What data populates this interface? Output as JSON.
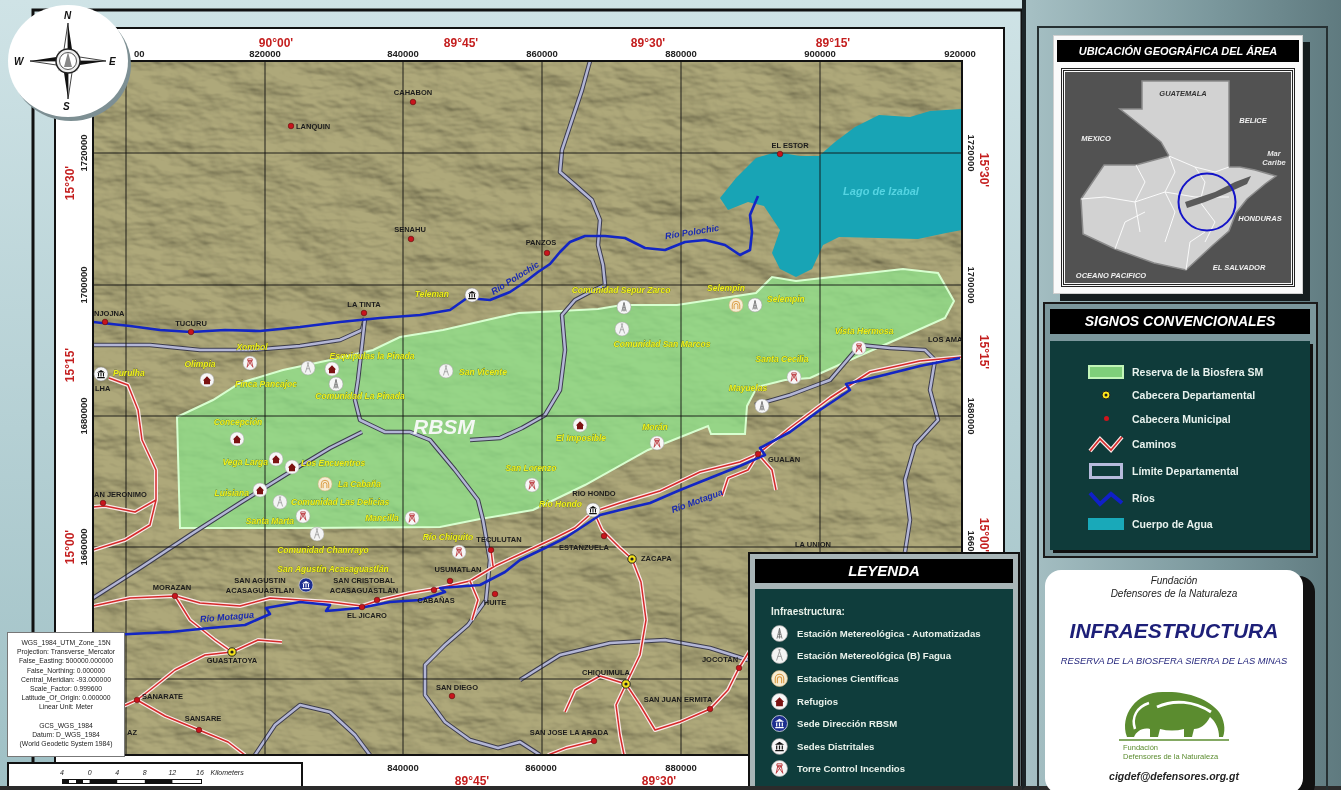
{
  "compass": {
    "north": "N",
    "south": "S",
    "east": "E",
    "west": "W"
  },
  "grid": {
    "top_eastings": [
      "00",
      "820000",
      "840000",
      "860000",
      "880000",
      "900000",
      "920000"
    ],
    "top_longitudes": [
      "90°00'",
      "89°45'",
      "89°30'",
      "89°15'"
    ],
    "left_northings": [
      "1720000",
      "1700000",
      "1680000",
      "1660000"
    ],
    "left_latitudes": [
      "15°30'",
      "15°15'",
      "15°00'"
    ],
    "right_northings": [
      "1720000",
      "1700000",
      "1680000",
      "1660"
    ],
    "right_latitudes": [
      "15°30'",
      "15°15'",
      "15°00'"
    ],
    "bottom_eastings": [
      "840000",
      "860000",
      "880000"
    ],
    "bottom_longitudes": [
      "89°45'",
      "89°30'"
    ]
  },
  "map": {
    "reserve_label": "RBSM",
    "lake_label": "Lago de Izabal",
    "river_labels": [
      "Río Polochic",
      "Río Polochic",
      "Río Motagua",
      "Río Motagua"
    ],
    "towns": [
      {
        "name": "CAHABON",
        "kind": "municipal"
      },
      {
        "name": "LANQUIN",
        "kind": "municipal"
      },
      {
        "name": "SENAHU",
        "kind": "municipal"
      },
      {
        "name": "LA TINTA",
        "kind": "municipal"
      },
      {
        "name": "TUCURU",
        "kind": "municipal"
      },
      {
        "name": "NJOJNA",
        "kind": "municipal"
      },
      {
        "name": "LHA",
        "kind": "label_only"
      },
      {
        "name": "PANZOS",
        "kind": "municipal"
      },
      {
        "name": "EL ESTOR",
        "kind": "municipal"
      },
      {
        "name": "LOS AMA",
        "kind": "label_only"
      },
      {
        "name": "AN JERONIMO",
        "kind": "municipal"
      },
      {
        "name": "MORAZAN",
        "kind": "municipal"
      },
      {
        "lines": [
          "SAN AGUSTIN",
          "ACASAGUASTLAN"
        ],
        "kind": "label_only"
      },
      {
        "lines": [
          "SAN CRISTOBAL",
          "ACASAGUASTLAN"
        ],
        "kind": "municipal"
      },
      {
        "name": "EL JICARO",
        "kind": "municipal"
      },
      {
        "name": "USUMATLAN",
        "kind": "municipal"
      },
      {
        "name": "CABAÑAS",
        "kind": "municipal"
      },
      {
        "name": "HUITE",
        "kind": "municipal"
      },
      {
        "name": "TECULUTAN",
        "kind": "municipal"
      },
      {
        "name": "RIO HONDO",
        "kind": "label_only"
      },
      {
        "name": "ESTANZUELA",
        "kind": "municipal"
      },
      {
        "name": "ZACAPA",
        "kind": "departmental"
      },
      {
        "name": "GUALAN",
        "kind": "municipal"
      },
      {
        "name": "LA UNION",
        "kind": "label_only"
      },
      {
        "name": "GUASTATOYA",
        "kind": "departmental"
      },
      {
        "name": "SANARATE",
        "kind": "municipal"
      },
      {
        "name": "SANSARE",
        "kind": "municipal"
      },
      {
        "name": "AZ",
        "kind": "label_only"
      },
      {
        "name": "SAN DIEGO",
        "kind": "municipal"
      },
      {
        "name": "CHIQUIMULA",
        "kind": "departmental"
      },
      {
        "name": "SAN JUAN ERMITA",
        "kind": "municipal"
      },
      {
        "name": "SAN JOSE LA ARADA",
        "kind": "municipal"
      },
      {
        "name": "JOCOTAN",
        "kind": "municipal"
      }
    ],
    "sites": [
      {
        "name": "Teleman",
        "kind": "district"
      },
      {
        "name": "Comunidad Sepur Zarco",
        "kind": "weather_auto"
      },
      {
        "name": "Selempin",
        "kind": "science"
      },
      {
        "name": "Selempin",
        "kind": "weather_auto"
      },
      {
        "name": "Vista Hermosa",
        "kind": "fire_tower"
      },
      {
        "name": "Comunidad San Marcos",
        "kind": "weather_b"
      },
      {
        "name": "San Vicente",
        "kind": "weather_b"
      },
      {
        "name": "Santa Cecilia",
        "kind": "fire_tower"
      },
      {
        "name": "Mayuelas",
        "kind": "weather_auto"
      },
      {
        "name": "Xombol",
        "kind": "fire_tower"
      },
      {
        "name": "Purulha",
        "kind": "district"
      },
      {
        "name": "Olimpia",
        "kind": "refuge"
      },
      {
        "name": "Finca Pancajoc",
        "kind": "weather_b"
      },
      {
        "name": "Esquipulas la Pinada",
        "kind": "refuge"
      },
      {
        "name": "Comunidad La Pinada",
        "kind": "weather_auto"
      },
      {
        "name": "Concepción",
        "kind": "refuge"
      },
      {
        "name": "Vega Larga",
        "kind": "refuge"
      },
      {
        "name": "Los Encuentros",
        "kind": "refuge"
      },
      {
        "name": "La Cabaña",
        "kind": "science"
      },
      {
        "name": "Luisiana",
        "kind": "refuge"
      },
      {
        "name": "Comunidad Las Delicias",
        "kind": "weather_b"
      },
      {
        "name": "Santa Marta",
        "kind": "fire_tower"
      },
      {
        "name": "Mancilla",
        "kind": "fire_tower"
      },
      {
        "name": "Comunidad Chanrrayo",
        "kind": "weather_b"
      },
      {
        "name": "San Agustín Acasaguastlán",
        "kind": "hq"
      },
      {
        "name": "Río Chiquito",
        "kind": "fire_tower"
      },
      {
        "name": "El Imposible",
        "kind": "refuge"
      },
      {
        "name": "Morán",
        "kind": "fire_tower"
      },
      {
        "name": "San Lorenzo",
        "kind": "fire_tower"
      },
      {
        "name": "Río Hondo",
        "kind": "district"
      }
    ]
  },
  "projection": {
    "lines": [
      "WGS_1984_UTM_Zone_15N",
      "Projection: Transverse_Mercator",
      "False_Easting: 500000.000000",
      "False_Northing: 0.000000",
      "Central_Meridian: -93.000000",
      "Scale_Factor: 0.999600",
      "Latitude_Of_Origin: 0.000000",
      "Linear Unit: Meter"
    ],
    "datum_lines": [
      "GCS_WGS_1984",
      "Datum: D_WGS_1984",
      "(World Geodetic System 1984)"
    ]
  },
  "scale": {
    "ticks": [
      "4",
      "0",
      "4",
      "8",
      "12",
      "16"
    ],
    "unit": "Kilometers"
  },
  "legend": {
    "title": "LEYENDA",
    "heading": "Infraestructura:",
    "items": [
      {
        "kind": "weather_auto",
        "label": "Estación Metereológica - Automatizadas"
      },
      {
        "kind": "weather_b",
        "label": "Estación Metereológica (B) Fagua"
      },
      {
        "kind": "science",
        "label": "Estaciones Científicas"
      },
      {
        "kind": "refuge",
        "label": "Refugios"
      },
      {
        "kind": "hq",
        "label": "Sede Dirección RBSM"
      },
      {
        "kind": "district",
        "label": "Sedes Distritales"
      },
      {
        "kind": "fire_tower",
        "label": "Torre Control Incendios"
      }
    ]
  },
  "location": {
    "title": "UBICACIÓN GEOGRÁFICA DEL ÁREA",
    "guatemala": "GUATEMALA",
    "belize": "BELICE",
    "mexico": "MEXICO",
    "sea": [
      "Mar",
      "Caribe"
    ],
    "honduras": "HONDURAS",
    "el_salvador": "EL SALVADOR",
    "ocean": "OCEANO PACIFICO"
  },
  "symbols": {
    "title": "SIGNOS CONVENCIONALES",
    "items": [
      {
        "kind": "reserve",
        "label": "Reserva de la Biosfera SM"
      },
      {
        "kind": "dept_capital",
        "label": "Cabecera Departamental"
      },
      {
        "kind": "municipal",
        "label": "Cabecera Municipal"
      },
      {
        "kind": "road",
        "label": "Caminos"
      },
      {
        "kind": "boundary",
        "label": "Límite Departamental"
      },
      {
        "kind": "river",
        "label": "Ríos"
      },
      {
        "kind": "water",
        "label": "Cuerpo de Agua"
      }
    ]
  },
  "card": {
    "org_line_1": "Fundación",
    "org_line_2": "Defensores de la Naturaleza",
    "title": "INFRAESTRUCTURA",
    "subtitle": "RESERVA DE LA BIOSFERA SIERRA DE LAS MINAS",
    "logo_line_1": "Fundación",
    "logo_line_2": "Defensores de la Naturaleza",
    "email": "cigdef@defensores.org.gt"
  }
}
